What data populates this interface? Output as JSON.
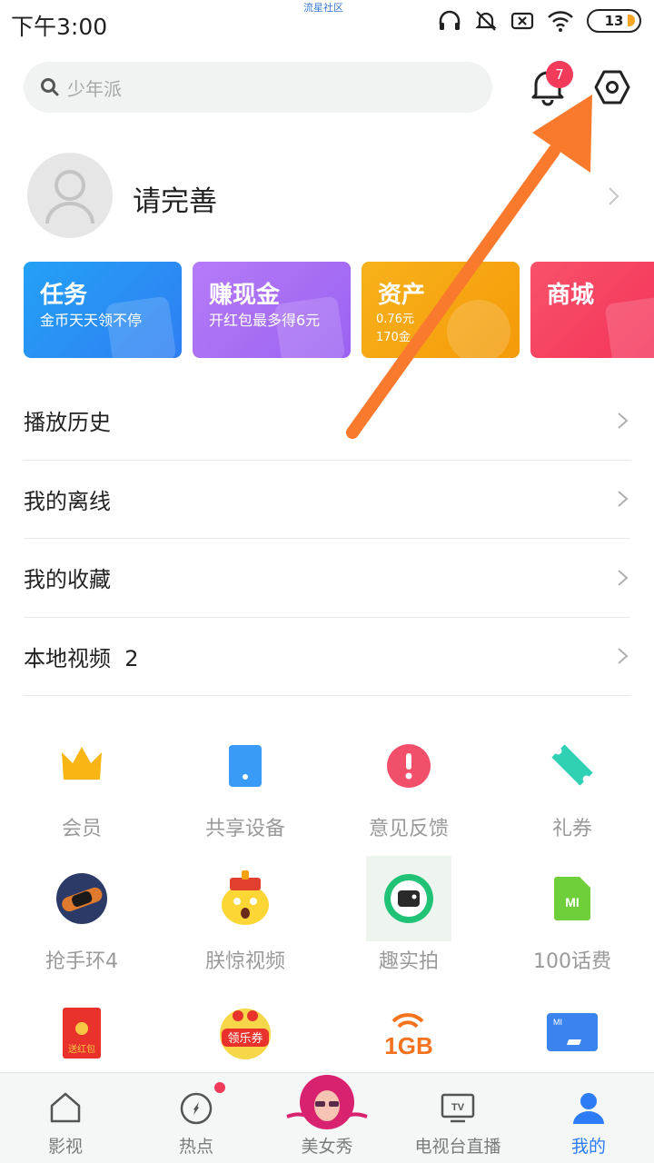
{
  "status_bar": {
    "time": "下午3:00",
    "carrier_label": "流星社区",
    "battery": "13"
  },
  "search": {
    "placeholder": "少年派"
  },
  "notifications": {
    "count": "7"
  },
  "profile": {
    "name": "请完善"
  },
  "cards": [
    {
      "title": "任务",
      "subtitle": "金币天天领不停",
      "color": "#2a8df3"
    },
    {
      "title": "赚现金",
      "subtitle": "开红包最多得6元",
      "color": "#a86ef5"
    },
    {
      "title": "资产",
      "line1": "0.76元",
      "line2": "170金",
      "color": "#f6a00d"
    },
    {
      "title": "商城",
      "color": "#f6405e"
    }
  ],
  "menu": [
    {
      "label": "播放历史"
    },
    {
      "label": "我的离线"
    },
    {
      "label": "我的收藏"
    },
    {
      "label": "本地视频  2"
    }
  ],
  "grid": [
    {
      "label": "会员",
      "icon": "crown-icon"
    },
    {
      "label": "共享设备",
      "icon": "device-icon"
    },
    {
      "label": "意见反馈",
      "icon": "feedback-icon"
    },
    {
      "label": "礼券",
      "icon": "ticket-icon"
    },
    {
      "label": "抢手环4",
      "icon": "band-icon"
    },
    {
      "label": "朕惊视频",
      "icon": "emperor-icon"
    },
    {
      "label": "趣实拍",
      "icon": "camera-icon"
    },
    {
      "label": "100话费",
      "icon": "sim-icon"
    },
    {
      "label": "",
      "icon": "red-packet-icon"
    },
    {
      "label": "",
      "icon": "coupon-icon",
      "icon_text": "领乐券"
    },
    {
      "label": "",
      "icon": "data-1gb-icon",
      "icon_text": "1GB"
    },
    {
      "label": "",
      "icon": "mi-card-icon",
      "icon_text": "MI"
    }
  ],
  "bottom_nav": [
    {
      "label": "影视"
    },
    {
      "label": "热点"
    },
    {
      "label": "美女秀"
    },
    {
      "label": "电视台直播"
    },
    {
      "label": "我的"
    }
  ],
  "colors": {
    "accent": "#2d7cf6",
    "badge": "#f23a5b",
    "arrow": "#f97a2d"
  }
}
